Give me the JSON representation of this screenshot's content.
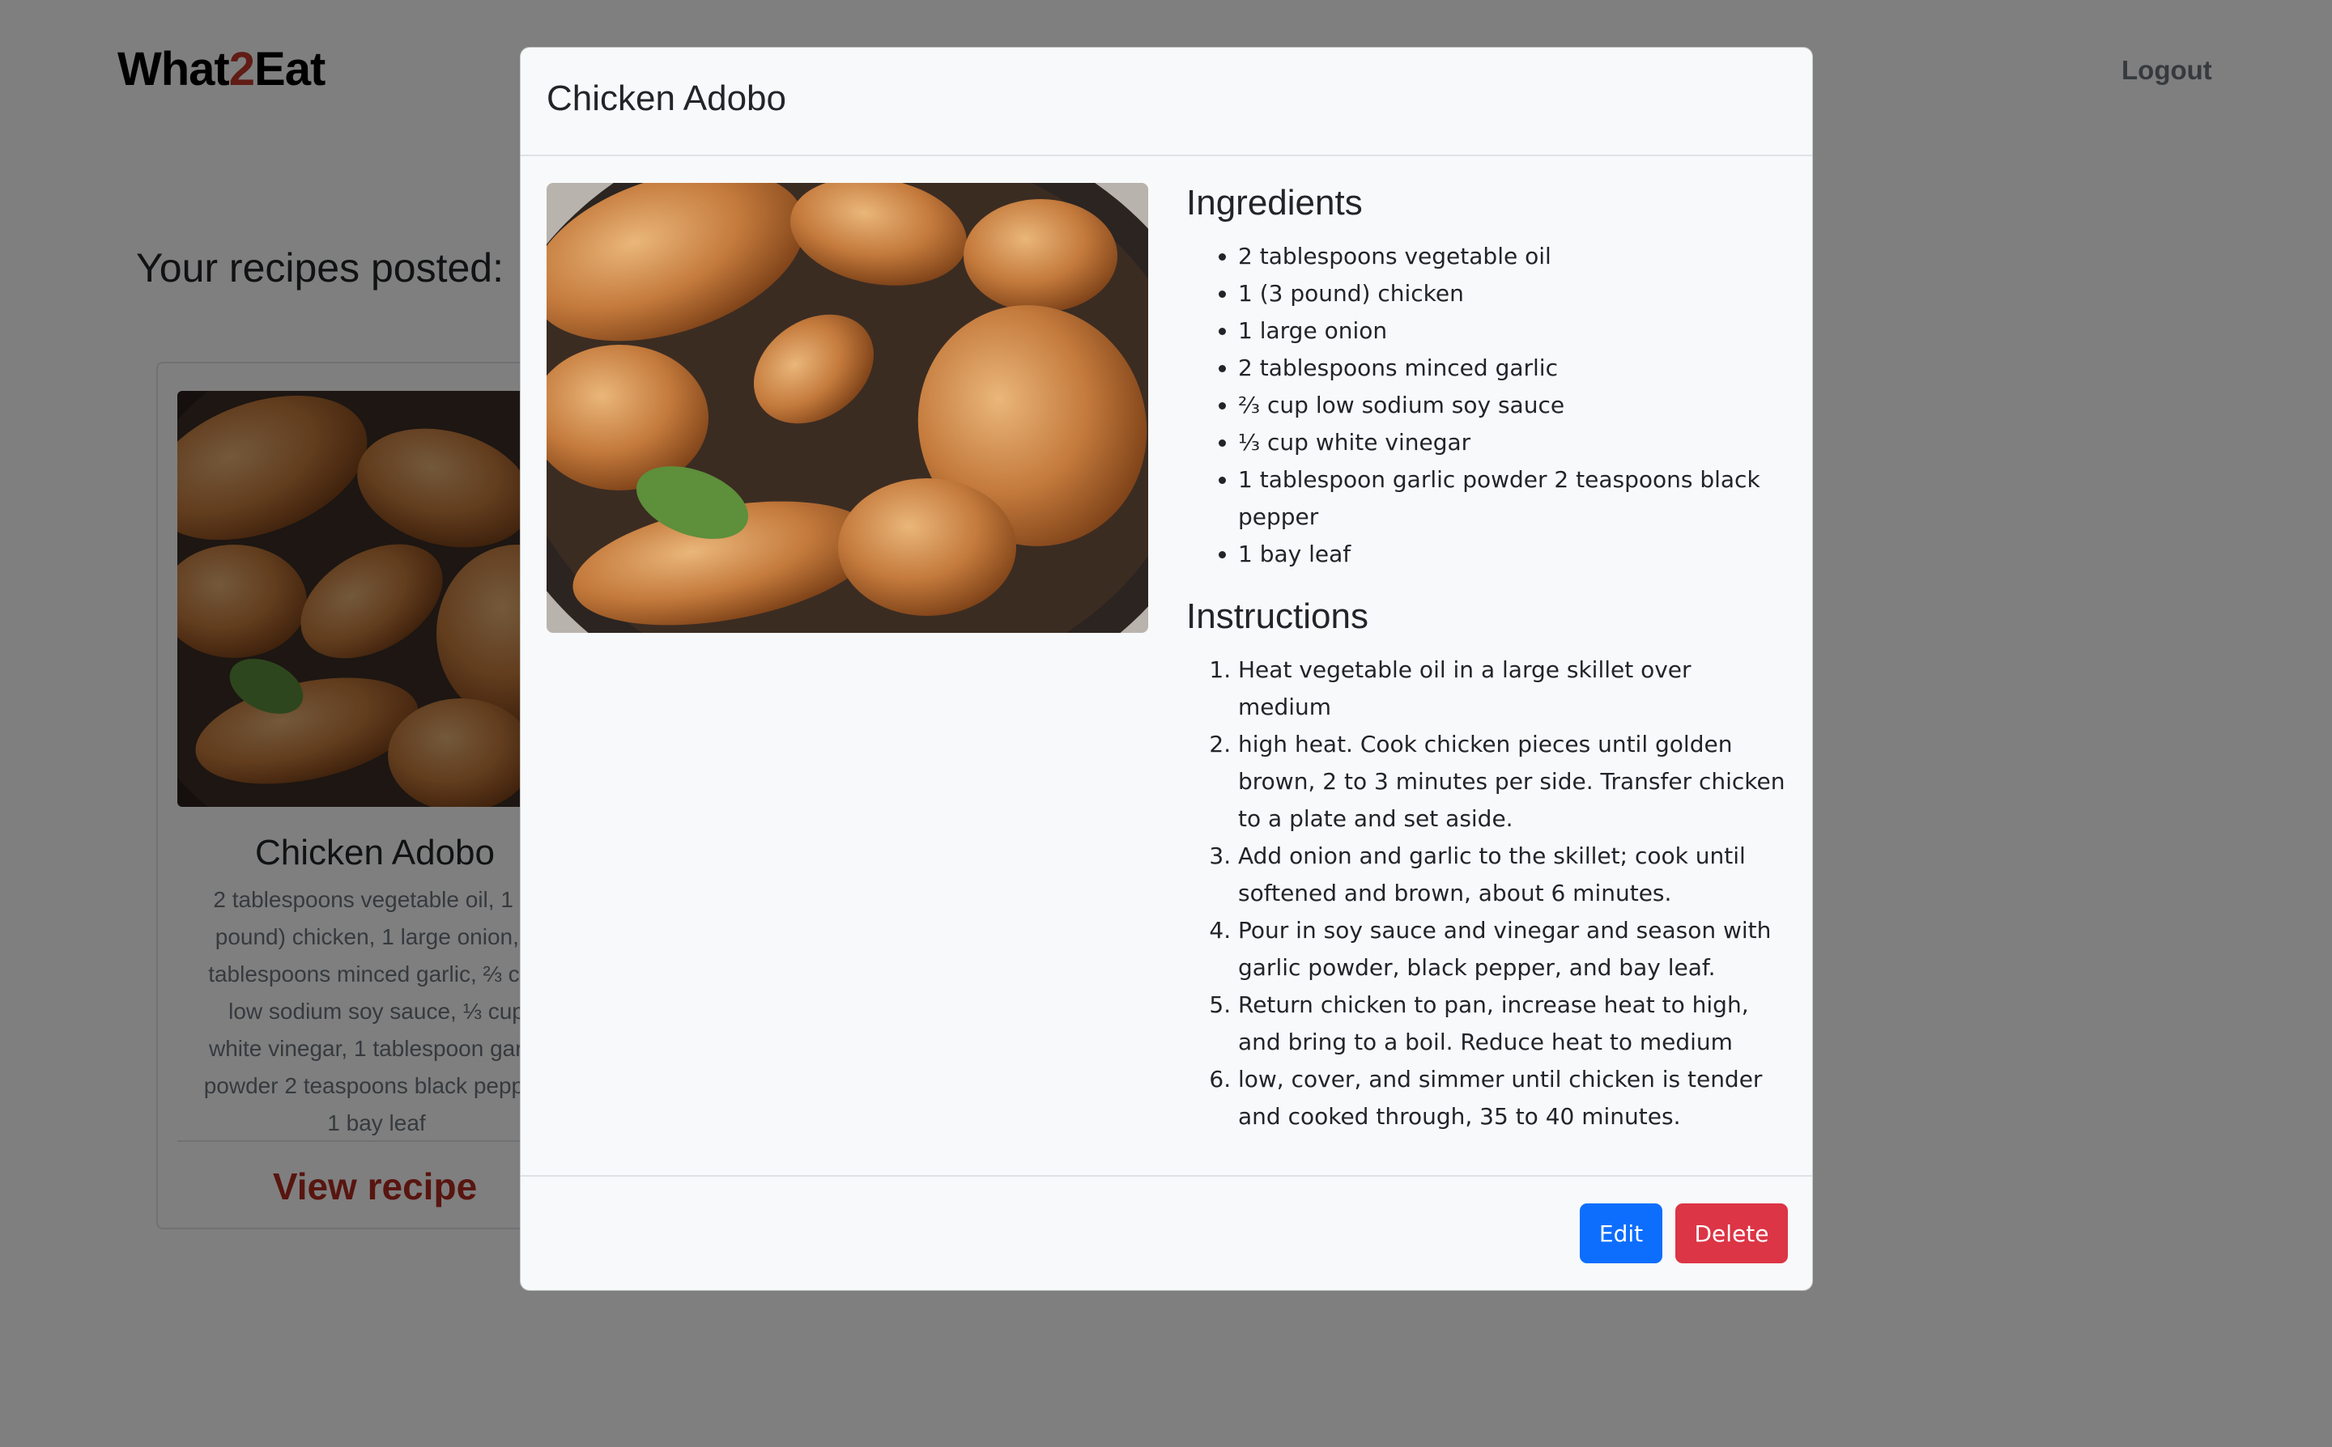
{
  "navbar": {
    "brand_prefix": "What",
    "brand_accent": "2",
    "brand_suffix": "Eat",
    "logout_label": "Logout"
  },
  "page": {
    "heading": "Your recipes posted:"
  },
  "card": {
    "title": "Chicken Adobo",
    "text": "2 tablespoons vegetable oil, 1 (3 pound) chicken, 1 large onion, 2 tablespoons minced garlic, ⅔ cup low sodium soy sauce, ⅓ cup white vinegar, 1 tablespoon garlic powder 2 teaspoons black pepper, 1 bay leaf",
    "link_label": "View recipe"
  },
  "modal": {
    "title": "Chicken Adobo",
    "ingredients_heading": "Ingredients",
    "ingredients": [
      "2 tablespoons vegetable oil",
      "1 (3 pound) chicken",
      "1 large onion",
      "2 tablespoons minced garlic",
      "⅔ cup low sodium soy sauce",
      "⅓ cup white vinegar",
      "1 tablespoon garlic powder 2 teaspoons black pepper",
      "1 bay leaf"
    ],
    "instructions_heading": "Instructions",
    "instructions": [
      "Heat vegetable oil in a large skillet over medium",
      "high heat. Cook chicken pieces until golden brown, 2 to 3 minutes per side. Transfer chicken to a plate and set aside.",
      "Add onion and garlic to the skillet; cook until softened and brown, about 6 minutes.",
      "Pour in soy sauce and vinegar and season with garlic powder, black pepper, and bay leaf.",
      "Return chicken to pan, increase heat to high, and bring to a boil. Reduce heat to medium",
      "low, cover, and simmer until chicken is tender and cooked through, 35 to 40 minutes."
    ],
    "edit_label": "Edit",
    "delete_label": "Delete"
  },
  "colors": {
    "brand_accent": "#c0392b",
    "primary": "#0d6efd",
    "danger": "#dc3545",
    "link": "#b02a21"
  }
}
